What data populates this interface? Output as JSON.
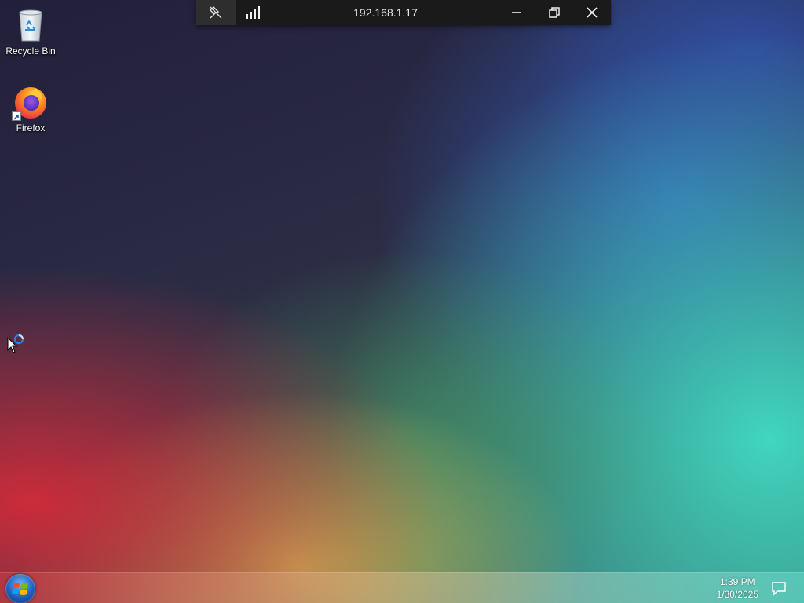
{
  "desktop": {
    "icons": [
      {
        "label": "Recycle Bin",
        "icon": "recycle-bin-icon"
      },
      {
        "label": "Firefox",
        "icon": "firefox-icon"
      }
    ]
  },
  "remote_bar": {
    "title": "192.168.1.17",
    "icons": [
      "pin-icon",
      "connection-quality-icon",
      "minimize-icon",
      "restore-icon",
      "close-icon"
    ]
  },
  "taskbar": {
    "start_icon": "windows-start-icon",
    "time": "1:39 PM",
    "date": "1/30/2025",
    "action_center_icon": "action-center-icon"
  },
  "colors": {
    "remote_bar_bg": "#1a1a1a",
    "wallpaper_red": "#d42b3a",
    "wallpaper_teal": "#40d6be",
    "wallpaper_blue": "#3258b4",
    "wallpaper_dark": "#221f3a"
  }
}
